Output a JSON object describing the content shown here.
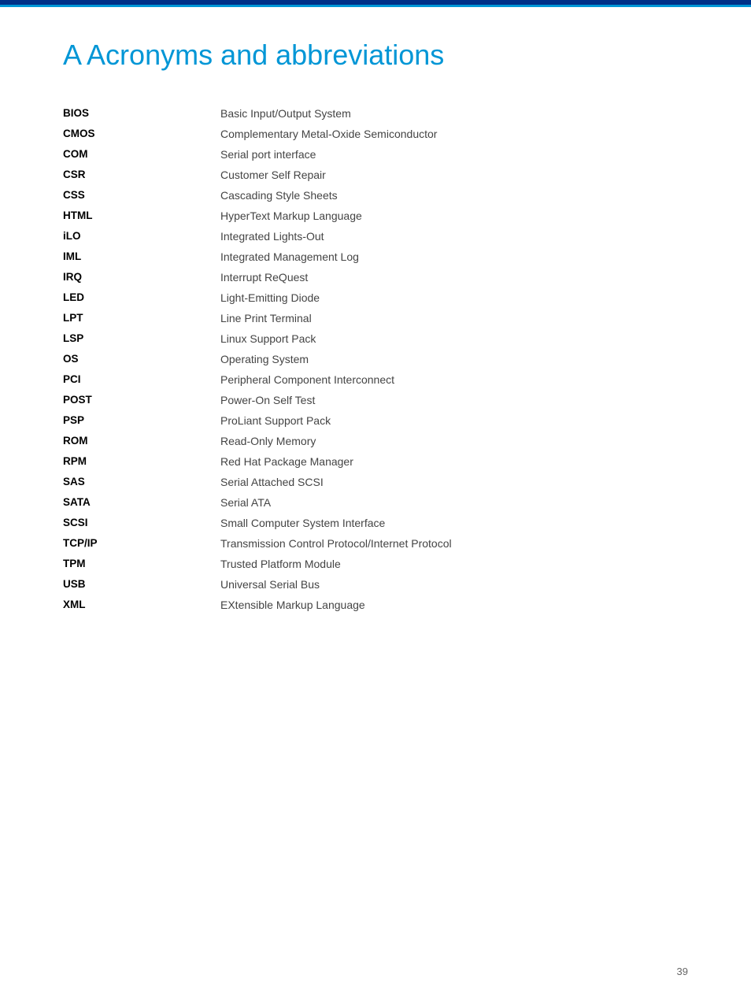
{
  "header": {
    "top_bar_color": "#003087",
    "accent_color": "#0096d6"
  },
  "page": {
    "title": "A Acronyms and abbreviations",
    "page_number": "39"
  },
  "acronyms": [
    {
      "abbr": "BIOS",
      "definition": "Basic Input/Output System"
    },
    {
      "abbr": "CMOS",
      "definition": "Complementary Metal-Oxide Semiconductor"
    },
    {
      "abbr": "COM",
      "definition": "Serial port interface"
    },
    {
      "abbr": "CSR",
      "definition": "Customer Self Repair"
    },
    {
      "abbr": "CSS",
      "definition": "Cascading Style Sheets"
    },
    {
      "abbr": "HTML",
      "definition": "HyperText Markup Language"
    },
    {
      "abbr": "iLO",
      "definition": "Integrated Lights-Out"
    },
    {
      "abbr": "IML",
      "definition": "Integrated Management Log"
    },
    {
      "abbr": "IRQ",
      "definition": "Interrupt ReQuest"
    },
    {
      "abbr": "LED",
      "definition": "Light-Emitting Diode"
    },
    {
      "abbr": "LPT",
      "definition": "Line Print Terminal"
    },
    {
      "abbr": "LSP",
      "definition": "Linux Support Pack"
    },
    {
      "abbr": "OS",
      "definition": "Operating System"
    },
    {
      "abbr": "PCI",
      "definition": "Peripheral Component Interconnect"
    },
    {
      "abbr": "POST",
      "definition": "Power-On Self Test"
    },
    {
      "abbr": "PSP",
      "definition": "ProLiant Support Pack"
    },
    {
      "abbr": "ROM",
      "definition": "Read-Only Memory"
    },
    {
      "abbr": "RPM",
      "definition": "Red Hat Package Manager"
    },
    {
      "abbr": "SAS",
      "definition": "Serial Attached SCSI"
    },
    {
      "abbr": "SATA",
      "definition": "Serial ATA"
    },
    {
      "abbr": "SCSI",
      "definition": "Small Computer System Interface"
    },
    {
      "abbr": "TCP/IP",
      "definition": "Transmission Control Protocol/Internet Protocol"
    },
    {
      "abbr": "TPM",
      "definition": "Trusted Platform Module"
    },
    {
      "abbr": "USB",
      "definition": "Universal Serial Bus"
    },
    {
      "abbr": "XML",
      "definition": "EXtensible Markup Language"
    }
  ]
}
